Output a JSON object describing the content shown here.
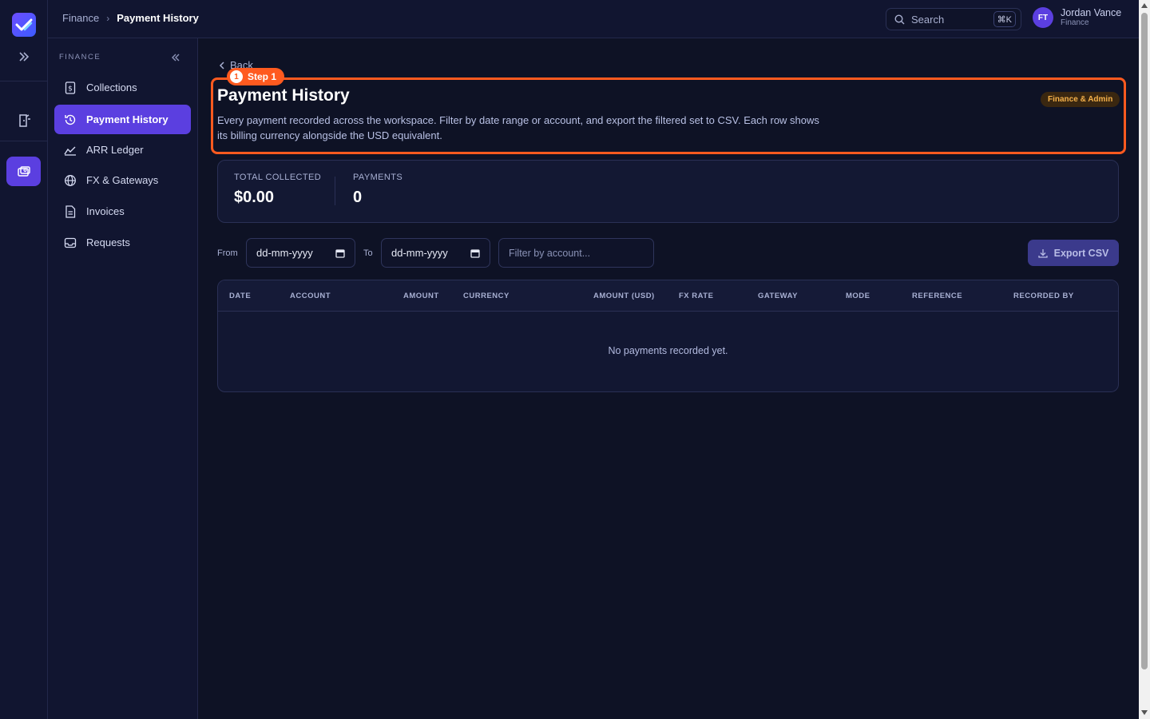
{
  "breadcrumb": {
    "parent": "Finance",
    "current": "Payment History"
  },
  "search": {
    "label": "Search",
    "shortcut": "⌘K"
  },
  "user": {
    "initials": "FT",
    "name": "Jordan Vance",
    "role": "Finance"
  },
  "sidebar": {
    "section_title": "FINANCE",
    "items": [
      {
        "label": "Collections",
        "icon": "dollar-receipt-icon",
        "active": false
      },
      {
        "label": "Payment History",
        "icon": "history-icon",
        "active": true
      },
      {
        "label": "ARR Ledger",
        "icon": "area-chart-icon",
        "active": false
      },
      {
        "label": "FX & Gateways",
        "icon": "globe-icon",
        "active": false
      },
      {
        "label": "Invoices",
        "icon": "document-icon",
        "active": false
      },
      {
        "label": "Requests",
        "icon": "inbox-icon",
        "active": false
      }
    ]
  },
  "page": {
    "back_label": "Back",
    "step_number": "1",
    "step_label": "Step 1",
    "title": "Payment History",
    "description": "Every payment recorded across the workspace. Filter by date range or account, and export the filtered set to CSV. Each row shows its billing currency alongside the USD equivalent.",
    "badge": "Finance & Admin"
  },
  "stats": {
    "total_label": "TOTAL COLLECTED",
    "total_value": "$0.00",
    "payments_label": "PAYMENTS",
    "payments_value": "0"
  },
  "filters": {
    "from_label": "From",
    "from_value": "dd-mm-yyyy",
    "to_label": "To",
    "to_value": "dd-mm-yyyy",
    "account_placeholder": "Filter by account...",
    "export_label": "Export CSV"
  },
  "table": {
    "columns": [
      "DATE",
      "ACCOUNT",
      "AMOUNT",
      "CURRENCY",
      "AMOUNT (USD)",
      "FX RATE",
      "GATEWAY",
      "MODE",
      "REFERENCE",
      "RECORDED BY"
    ],
    "empty_message": "No payments recorded yet."
  },
  "colors": {
    "accent": "#5b3fe0",
    "highlight": "#ff5a1f",
    "background": "#0e1225",
    "badge_text": "#f5b14a"
  }
}
